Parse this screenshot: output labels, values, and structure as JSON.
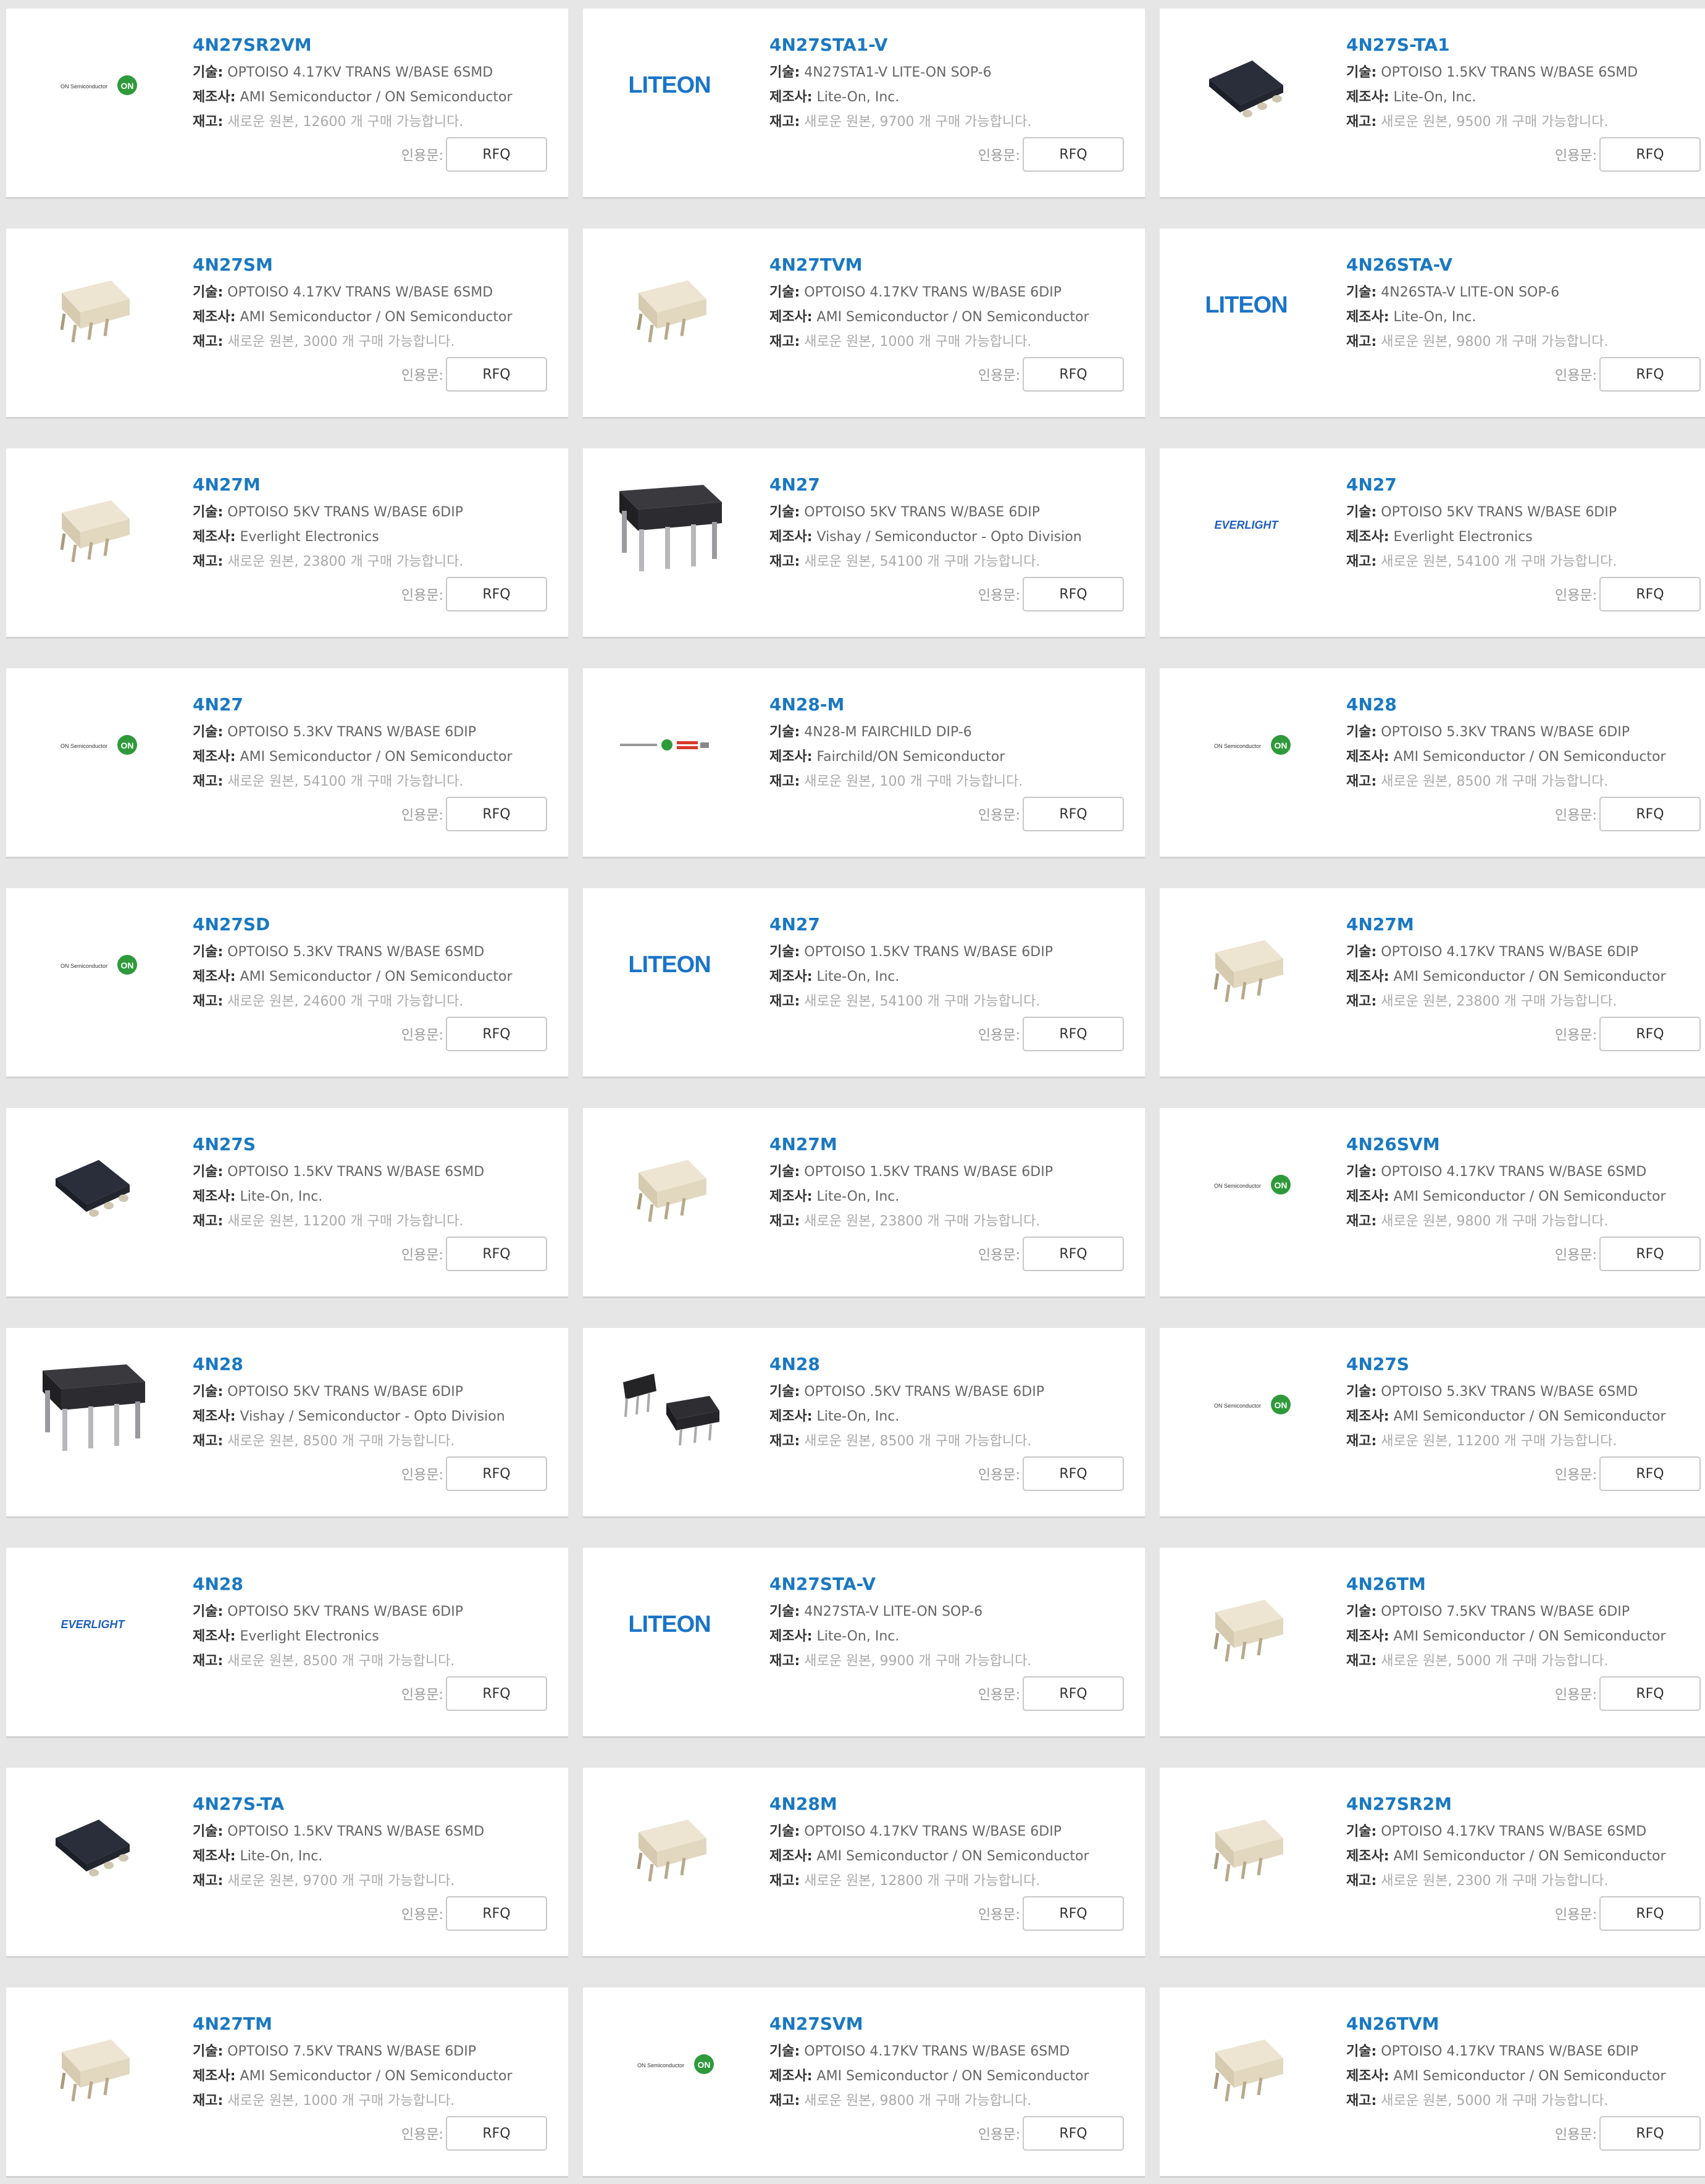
{
  "labels": {
    "tech": "기술:",
    "mfr": "제조사:",
    "stock": "재고:",
    "quote": "인용문:",
    "rfq": "RFQ"
  },
  "logos": {
    "liteon": "LITEON",
    "everlight": "EVERLIGHT",
    "on": "ON",
    "on_semi": "ON Semiconductor"
  },
  "colors": {
    "part_link": "#1a78c2",
    "on_green": "#2e9a3a",
    "liteon_blue": "#1a74c8",
    "everlight_blue": "#1f5fc0"
  },
  "products": [
    {
      "pn": "4N27SR2VM",
      "tech": "OPTOISO 4.17KV TRANS W/BASE 6SMD",
      "mfr": "AMI Semiconductor / ON Semiconductor",
      "stock": "새로운 원본, 12600 개 구매 가능합니다.",
      "img": "on-semiconductor-logo"
    },
    {
      "pn": "4N27STA1-V",
      "tech": "4N27STA1-V LITE-ON SOP-6",
      "mfr": "Lite-On, Inc.",
      "stock": "새로운 원본, 9700 개 구매 가능합니다.",
      "img": "liteon-logo"
    },
    {
      "pn": "4N27S-TA1",
      "tech": "OPTOISO 1.5KV TRANS W/BASE 6SMD",
      "mfr": "Lite-On, Inc.",
      "stock": "새로운 원본, 9500 개 구매 가능합니다.",
      "img": "black-smd-package-image"
    },
    {
      "pn": "4N27SM",
      "tech": "OPTOISO 4.17KV TRANS W/BASE 6SMD",
      "mfr": "AMI Semiconductor / ON Semiconductor",
      "stock": "새로운 원본, 3000 개 구매 가능합니다.",
      "img": "white-dip-package-image"
    },
    {
      "pn": "4N27TVM",
      "tech": "OPTOISO 4.17KV TRANS W/BASE 6DIP",
      "mfr": "AMI Semiconductor / ON Semiconductor",
      "stock": "새로운 원본, 1000 개 구매 가능합니다.",
      "img": "white-dip-package-image"
    },
    {
      "pn": "4N26STA-V",
      "tech": "4N26STA-V LITE-ON SOP-6",
      "mfr": "Lite-On, Inc.",
      "stock": "새로운 원본, 9800 개 구매 가능합니다.",
      "img": "liteon-logo"
    },
    {
      "pn": "4N27M",
      "tech": "OPTOISO 5KV TRANS W/BASE 6DIP",
      "mfr": "Everlight Electronics",
      "stock": "새로운 원본, 23800 개 구매 가능합니다.",
      "img": "white-dip-package-image"
    },
    {
      "pn": "4N27",
      "tech": "OPTOISO 5KV TRANS W/BASE 6DIP",
      "mfr": "Vishay / Semiconductor - Opto Division",
      "stock": "새로운 원본, 54100 개 구매 가능합니다.",
      "img": "black-dip-package-image"
    },
    {
      "pn": "4N27",
      "tech": "OPTOISO 5KV TRANS W/BASE 6DIP",
      "mfr": "Everlight Electronics",
      "stock": "새로운 원본, 54100 개 구매 가능합니다.",
      "img": "everlight-logo"
    },
    {
      "pn": "4N27",
      "tech": "OPTOISO 5.3KV TRANS W/BASE 6DIP",
      "mfr": "AMI Semiconductor / ON Semiconductor",
      "stock": "새로운 원본, 54100 개 구매 가능합니다.",
      "img": "on-semiconductor-logo"
    },
    {
      "pn": "4N28-M",
      "tech": "4N28-M FAIRCHILD DIP-6",
      "mfr": "Fairchild/ON Semiconductor",
      "stock": "새로운 원본, 100 개 구매 가능합니다.",
      "img": "fairchild-on-logo"
    },
    {
      "pn": "4N28",
      "tech": "OPTOISO 5.3KV TRANS W/BASE 6DIP",
      "mfr": "AMI Semiconductor / ON Semiconductor",
      "stock": "새로운 원본, 8500 개 구매 가능합니다.",
      "img": "on-semiconductor-logo"
    },
    {
      "pn": "4N27SD",
      "tech": "OPTOISO 5.3KV TRANS W/BASE 6SMD",
      "mfr": "AMI Semiconductor / ON Semiconductor",
      "stock": "새로운 원본, 24600 개 구매 가능합니다.",
      "img": "on-semiconductor-logo"
    },
    {
      "pn": "4N27",
      "tech": "OPTOISO 1.5KV TRANS W/BASE 6DIP",
      "mfr": "Lite-On, Inc.",
      "stock": "새로운 원본, 54100 개 구매 가능합니다.",
      "img": "liteon-logo"
    },
    {
      "pn": "4N27M",
      "tech": "OPTOISO 4.17KV TRANS W/BASE 6DIP",
      "mfr": "AMI Semiconductor / ON Semiconductor",
      "stock": "새로운 원본, 23800 개 구매 가능합니다.",
      "img": "white-dip-package-image"
    },
    {
      "pn": "4N27S",
      "tech": "OPTOISO 1.5KV TRANS W/BASE 6SMD",
      "mfr": "Lite-On, Inc.",
      "stock": "새로운 원본, 11200 개 구매 가능합니다.",
      "img": "black-smd-package-image"
    },
    {
      "pn": "4N27M",
      "tech": "OPTOISO 1.5KV TRANS W/BASE 6DIP",
      "mfr": "Lite-On, Inc.",
      "stock": "새로운 원본, 23800 개 구매 가능합니다.",
      "img": "white-dip-package-image"
    },
    {
      "pn": "4N26SVM",
      "tech": "OPTOISO 4.17KV TRANS W/BASE 6SMD",
      "mfr": "AMI Semiconductor / ON Semiconductor",
      "stock": "새로운 원본, 9800 개 구매 가능합니다.",
      "img": "on-semiconductor-logo"
    },
    {
      "pn": "4N28",
      "tech": "OPTOISO 5KV TRANS W/BASE 6DIP",
      "mfr": "Vishay / Semiconductor - Opto Division",
      "stock": "새로운 원본, 8500 개 구매 가능합니다.",
      "img": "black-dip-package-image"
    },
    {
      "pn": "4N28",
      "tech": "OPTOISO .5KV TRANS W/BASE 6DIP",
      "mfr": "Lite-On, Inc.",
      "stock": "새로운 원본, 8500 개 구매 가능합니다.",
      "img": "black-dip-pair-image"
    },
    {
      "pn": "4N27S",
      "tech": "OPTOISO 5.3KV TRANS W/BASE 6SMD",
      "mfr": "AMI Semiconductor / ON Semiconductor",
      "stock": "새로운 원본, 11200 개 구매 가능합니다.",
      "img": "on-semiconductor-logo"
    },
    {
      "pn": "4N28",
      "tech": "OPTOISO 5KV TRANS W/BASE 6DIP",
      "mfr": "Everlight Electronics",
      "stock": "새로운 원본, 8500 개 구매 가능합니다.",
      "img": "everlight-logo"
    },
    {
      "pn": "4N27STA-V",
      "tech": "4N27STA-V LITE-ON SOP-6",
      "mfr": "Lite-On, Inc.",
      "stock": "새로운 원본, 9900 개 구매 가능합니다.",
      "img": "liteon-logo"
    },
    {
      "pn": "4N26TM",
      "tech": "OPTOISO 7.5KV TRANS W/BASE 6DIP",
      "mfr": "AMI Semiconductor / ON Semiconductor",
      "stock": "새로운 원본, 5000 개 구매 가능합니다.",
      "img": "white-dip-package-image"
    },
    {
      "pn": "4N27S-TA",
      "tech": "OPTOISO 1.5KV TRANS W/BASE 6SMD",
      "mfr": "Lite-On, Inc.",
      "stock": "새로운 원본, 9700 개 구매 가능합니다.",
      "img": "black-smd-package-image"
    },
    {
      "pn": "4N28M",
      "tech": "OPTOISO 4.17KV TRANS W/BASE 6DIP",
      "mfr": "AMI Semiconductor / ON Semiconductor",
      "stock": "새로운 원본, 12800 개 구매 가능합니다.",
      "img": "white-dip-package-image"
    },
    {
      "pn": "4N27SR2M",
      "tech": "OPTOISO 4.17KV TRANS W/BASE 6SMD",
      "mfr": "AMI Semiconductor / ON Semiconductor",
      "stock": "새로운 원본, 2300 개 구매 가능합니다.",
      "img": "white-dip-package-image"
    },
    {
      "pn": "4N27TM",
      "tech": "OPTOISO 7.5KV TRANS W/BASE 6DIP",
      "mfr": "AMI Semiconductor / ON Semiconductor",
      "stock": "새로운 원본, 1000 개 구매 가능합니다.",
      "img": "white-dip-package-image"
    },
    {
      "pn": "4N27SVM",
      "tech": "OPTOISO 4.17KV TRANS W/BASE 6SMD",
      "mfr": "AMI Semiconductor / ON Semiconductor",
      "stock": "새로운 원본, 9800 개 구매 가능합니다.",
      "img": "on-semiconductor-logo"
    },
    {
      "pn": "4N26TVM",
      "tech": "OPTOISO 4.17KV TRANS W/BASE 6DIP",
      "mfr": "AMI Semiconductor / ON Semiconductor",
      "stock": "새로운 원본, 5000 개 구매 가능합니다.",
      "img": "white-dip-package-image"
    }
  ]
}
